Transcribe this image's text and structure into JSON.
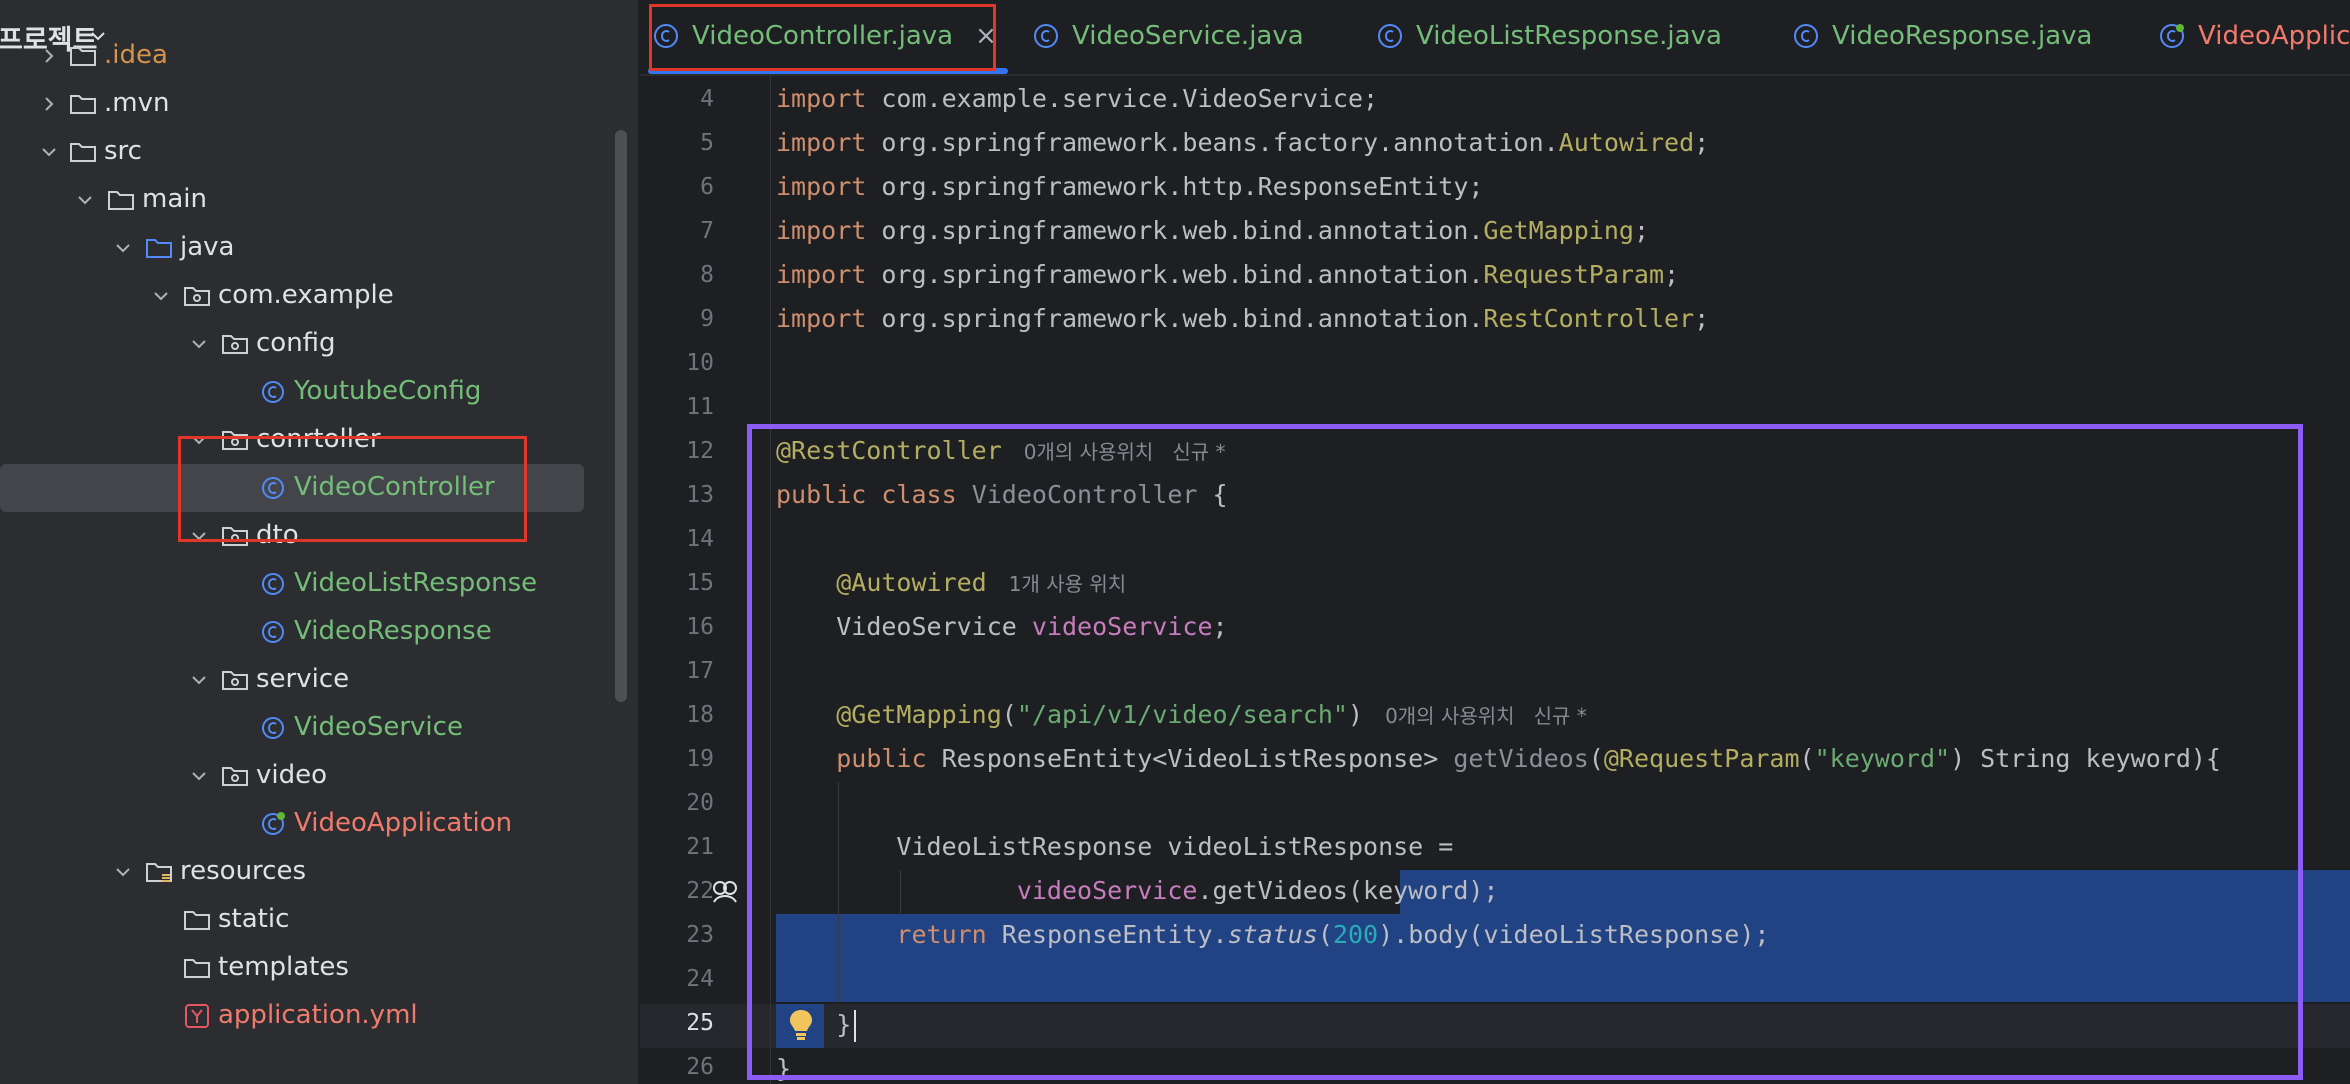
{
  "project_panel": {
    "title": "프로젝트",
    "tree": [
      {
        "label": ".idea",
        "type": "folder",
        "color": "#d4924b"
      },
      {
        "label": ".mvn",
        "type": "folder"
      },
      {
        "label": "src",
        "type": "folder"
      },
      {
        "label": "main",
        "type": "folder"
      },
      {
        "label": "java",
        "type": "source-folder"
      },
      {
        "label": "com.example",
        "type": "package"
      },
      {
        "label": "config",
        "type": "package"
      },
      {
        "label": "YoutubeConfig",
        "type": "class",
        "color": "#73bd79"
      },
      {
        "label": "conrtoller",
        "type": "package"
      },
      {
        "label": "VideoController",
        "type": "class",
        "color": "#73bd79"
      },
      {
        "label": "dto",
        "type": "package"
      },
      {
        "label": "VideoListResponse",
        "type": "class",
        "color": "#73bd79"
      },
      {
        "label": "VideoResponse",
        "type": "class",
        "color": "#73bd79"
      },
      {
        "label": "service",
        "type": "package"
      },
      {
        "label": "VideoService",
        "type": "class",
        "color": "#73bd79"
      },
      {
        "label": "video",
        "type": "package"
      },
      {
        "label": "VideoApplication",
        "type": "spring-app",
        "color": "#f07b6d"
      },
      {
        "label": "resources",
        "type": "resources-folder"
      },
      {
        "label": "static",
        "type": "folder"
      },
      {
        "label": "templates",
        "type": "folder"
      },
      {
        "label": "application.yml",
        "type": "yaml",
        "color": "#f07b6d"
      }
    ]
  },
  "tabs": [
    {
      "label": "VideoController.java",
      "active": true,
      "color": "#73bd79"
    },
    {
      "label": "VideoService.java",
      "color": "#73bd79"
    },
    {
      "label": "VideoListResponse.java",
      "color": "#73bd79"
    },
    {
      "label": "VideoResponse.java",
      "color": "#73bd79"
    },
    {
      "label": "VideoApplica",
      "color": "#f07b6d"
    }
  ],
  "tab_close": "×",
  "editor": {
    "line_numbers": [
      "4",
      "5",
      "6",
      "7",
      "8",
      "9",
      "10",
      "11",
      "12",
      "13",
      "14",
      "15",
      "16",
      "17",
      "18",
      "19",
      "20",
      "21",
      "22",
      "23",
      "24",
      "25",
      "26"
    ],
    "current_line": "25",
    "imports": [
      {
        "kw": "import",
        "path": " com.example.service.",
        "cls": "VideoService",
        "end": ";"
      },
      {
        "kw": "import",
        "path": " org.springframework.beans.factory.annotation.",
        "cls": "Autowired",
        "end": ";"
      },
      {
        "kw": "import",
        "path": " org.springframework.http.",
        "cls": "ResponseEntity",
        "end": ";"
      },
      {
        "kw": "import",
        "path": " org.springframework.web.bind.annotation.",
        "cls": "GetMapping",
        "end": ";"
      },
      {
        "kw": "import",
        "path": " org.springframework.web.bind.annotation.",
        "cls": "RequestParam",
        "end": ";"
      },
      {
        "kw": "import",
        "path": " org.springframework.web.bind.annotation.",
        "cls": "RestController",
        "end": ";"
      }
    ],
    "l12_annotation": "@RestController",
    "l12_hint": "0개의 사용위치   신규 *",
    "l13_public": "public",
    "l13_class": "class",
    "l13_name": "VideoController",
    "l13_brace": " {",
    "l15_annotation": "@Autowired",
    "l15_hint": "1개 사용 위치",
    "l16_type": "VideoService ",
    "l16_field": "videoService",
    "l16_end": ";",
    "l18_annotation": "@GetMapping",
    "l18_open": "(",
    "l18_str": "\"/api/v1/video/search\"",
    "l18_close": ")",
    "l18_hint": "0개의 사용위치   신규 *",
    "l19_public": "public",
    "l19_type": " ResponseEntity<VideoListResponse> ",
    "l19_method": "getVideos",
    "l19_open": "(",
    "l19_ann": "@RequestParam",
    "l19_p1": "(",
    "l19_str": "\"keyword\"",
    "l19_rest": ") String keyword){",
    "l21_text": "VideoListResponse videoListResponse =",
    "l22_field": "videoService",
    "l22_rest": ".getVideos(keyword);",
    "l23_return": "return",
    "l23_a": " ResponseEntity.",
    "l23_status": "status",
    "l23_b": "(",
    "l23_num": "200",
    "l23_c": ").body(videoListResponse);",
    "l25_brace": "}",
    "l26_brace": "}"
  },
  "colors": {
    "accent": "#3574f0",
    "highlight_red": "#e0372b",
    "highlight_purple": "#8b5cf6",
    "selection": "#214283"
  }
}
